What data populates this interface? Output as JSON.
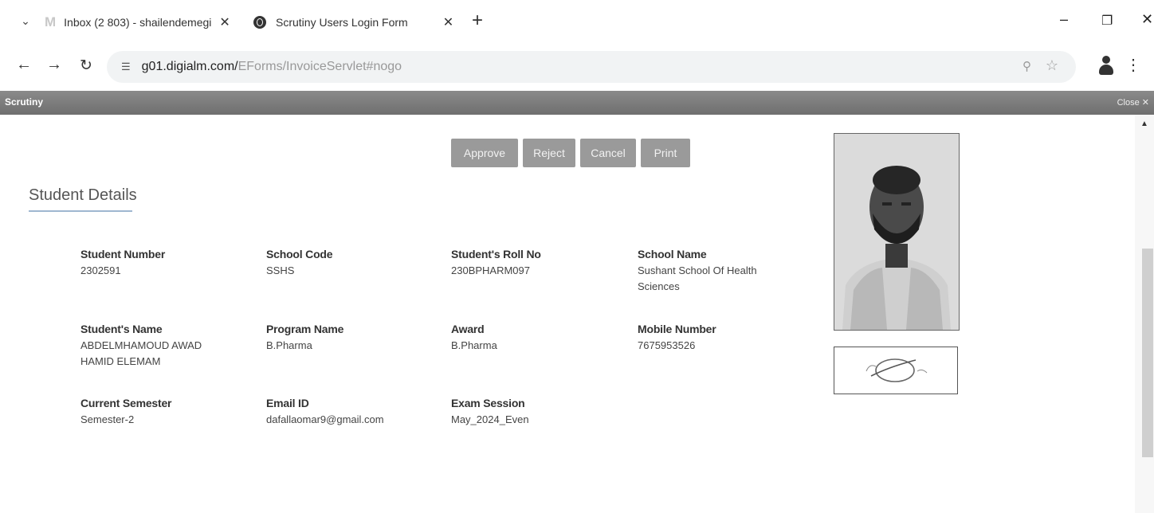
{
  "tabs": [
    {
      "title": "Inbox (2 803) - shailendemegi",
      "icon": "gmail-icon"
    },
    {
      "title": "Scrutiny Users Login Form",
      "icon": "globe-icon"
    }
  ],
  "address": {
    "url_main": "g01.digialm.com/",
    "url_rest": "EForms/InvoiceServlet#nogo"
  },
  "dialog": {
    "title": "Scrutiny",
    "close_label": "Close"
  },
  "actions": {
    "approve": "Approve",
    "reject": "Reject",
    "cancel": "Cancel",
    "print": "Print"
  },
  "section_title": "Student Details",
  "fields": {
    "student_number": {
      "label": "Student Number",
      "value": "2302591"
    },
    "school_code": {
      "label": "School Code",
      "value": "SSHS"
    },
    "roll_no": {
      "label": "Student's Roll No",
      "value": "230BPHARM097"
    },
    "school_name": {
      "label": "School Name",
      "value": "Sushant School Of Health Sciences"
    },
    "student_name": {
      "label": "Student's Name",
      "value": "ABDELMHAMOUD AWAD HAMID ELEMAM"
    },
    "program_name": {
      "label": "Program Name",
      "value": "B.Pharma"
    },
    "award": {
      "label": "Award",
      "value": "B.Pharma"
    },
    "mobile_number": {
      "label": "Mobile Number",
      "value": "7675953526"
    },
    "current_semester": {
      "label": "Current Semester",
      "value": "Semester-2"
    },
    "email_id": {
      "label": "Email ID",
      "value": "dafallaomar9@gmail.com"
    },
    "exam_session": {
      "label": "Exam Session",
      "value": "May_2024_Even"
    }
  },
  "colors": {
    "button_bg": "#9a9a9a",
    "header_bg": "#7b7b7b",
    "underline": "#9fb7d0"
  }
}
